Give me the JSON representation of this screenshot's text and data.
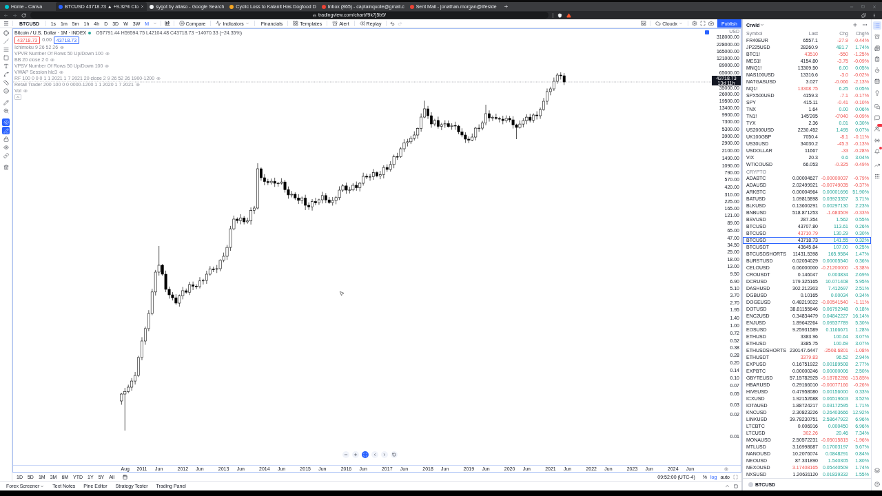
{
  "browser": {
    "tabs": [
      {
        "title": "Home - Canva",
        "selected": false
      },
      {
        "title": "BTCUSD 43718.73 ▲ +9.32% Clo",
        "selected": true
      },
      {
        "title": "sygot by aliaso - Google Search",
        "selected": false
      },
      {
        "title": "Cyclic Loss to Kalanit Has Dogfood D",
        "selected": false
      },
      {
        "title": "Inbox (865) - captainquote@gmail.c",
        "selected": false
      },
      {
        "title": "Sent Mail - jonathan.morgan@lifeside",
        "selected": false
      }
    ],
    "url": "tradingview.com/chart/f9k7j5b9/"
  },
  "toolbar": {
    "symbol": "BTCUSD",
    "intervals": [
      {
        "label": "1s",
        "selected": false
      },
      {
        "label": "1m",
        "selected": false
      },
      {
        "label": "5m",
        "selected": false
      },
      {
        "label": "1h",
        "selected": false
      },
      {
        "label": "4h",
        "selected": false
      },
      {
        "label": "D",
        "selected": false
      },
      {
        "label": "3D",
        "selected": false
      },
      {
        "label": "W",
        "selected": false
      },
      {
        "label": "3W",
        "selected": false
      },
      {
        "label": "M",
        "selected": true
      }
    ],
    "actions": [
      {
        "label": "Compare",
        "dropdown": false
      },
      {
        "label": "Indicators",
        "dropdown": true
      },
      {
        "label": "Financials",
        "dropdown": false
      },
      {
        "label": "Templates",
        "dropdown": false
      },
      {
        "label": "Alert",
        "dropdown": false
      },
      {
        "label": "Replay",
        "dropdown": false
      }
    ],
    "layout_name": "Cloudx",
    "publish": "Publish"
  },
  "drawing_tools": [
    {
      "selected": false
    },
    {
      "selected": false
    },
    {
      "selected": false
    },
    {
      "selected": false
    },
    {
      "selected": false
    },
    {
      "selected": false
    },
    {
      "selected": false
    },
    {
      "selected": false
    },
    {
      "selected": false
    },
    {
      "selected": false
    },
    {
      "selected": true
    },
    {
      "selected": true
    },
    {
      "selected": false
    },
    {
      "selected": false
    },
    {
      "selected": false
    },
    {
      "selected": false
    }
  ],
  "legend": {
    "title": "Bitcoin / U.S. Dollar · 1M · INDEX",
    "market_open": true,
    "ohlc": "O57791.44 H59594.75 L42104.48 C43718.73 −14070.33 (−24.35%)",
    "sell_price": "43718.73",
    "spread": "0.00",
    "buy_price": "43718.73",
    "indicators": [
      {
        "label": "Ichimoku 9 26 52 26",
        "visible": true
      },
      {
        "label": "VPVR Number Of Rows 50 Up/Down 100",
        "visible": true
      },
      {
        "label": "BB 20 close 2 0",
        "visible": true
      },
      {
        "label": "VPSV Number Of Rows 50 Up/Down 100",
        "visible": true
      },
      {
        "label": "VWAP Session hlc3",
        "visible": true
      },
      {
        "label": "RF 100 0 0 0 1 1 2021 1 7 2021 20 close 2 9 26 52 26 1900-1200",
        "visible": true
      },
      {
        "label": "Retail Trader 200 100 0 0 0000-1200 1 1 2020 1 7 2021",
        "visible": true
      },
      {
        "label": "Vol",
        "visible": true
      }
    ]
  },
  "chart": {
    "currency": "USD",
    "last_price": "43718.73",
    "countdown": "13d 11h",
    "price_labels": [
      "318000.00",
      "228000.00",
      "165000.00",
      "121000.00",
      "89000.00",
      "65000.00",
      "35000.00",
      "26000.00",
      "19500.00",
      "13400.00",
      "9900.00",
      "7300.00",
      "5300.00",
      "3900.00",
      "2900.00",
      "2100.00",
      "1490.00",
      "1090.00",
      "790.00",
      "570.00",
      "420.00",
      "310.00",
      "225.00",
      "165.00",
      "121.00",
      "89.00",
      "65.00",
      "47.00",
      "34.50",
      "25.00",
      "18.00",
      "13.00",
      "9.50",
      "6.90",
      "5.10",
      "3.70",
      "2.70",
      "1.95",
      "1.40",
      "1.00",
      "0.72",
      "0.52",
      "0.38",
      "0.28",
      "0.20",
      "0.14",
      "0.10",
      "0.07",
      "0.05",
      "0.03",
      "0.02",
      "0.01"
    ],
    "time_labels": [
      "Aug",
      "2011",
      "Jun",
      "2012",
      "Jun",
      "2013",
      "Jun",
      "2014",
      "Jun",
      "2015",
      "Jun",
      "2016",
      "Jun",
      "2017",
      "Jun",
      "2018",
      "Jun",
      "2019",
      "Jun",
      "2020",
      "Jun",
      "2021",
      "Jun",
      "2022",
      "Jun",
      "2023",
      "Jun",
      "2024",
      "Jun"
    ]
  },
  "range_bar": {
    "ranges": [
      "1D",
      "5D",
      "1M",
      "3M",
      "6M",
      "YTD",
      "1Y",
      "5Y",
      "All"
    ],
    "clock": "09:52:00 (UTC-4)",
    "scale_options": [
      {
        "label": "%",
        "selected": false
      },
      {
        "label": "log",
        "selected": true
      },
      {
        "label": "auto",
        "selected": false
      }
    ]
  },
  "bottom_tabs": [
    {
      "label": "Forex Screener",
      "dropdown": true
    },
    {
      "label": "Text Notes",
      "dropdown": false
    },
    {
      "label": "Pine Editor",
      "dropdown": false
    },
    {
      "label": "Strategy Tester",
      "dropdown": false
    },
    {
      "label": "Trading Panel",
      "dropdown": false
    }
  ],
  "watchlist": {
    "name": "Crwld",
    "columns": [
      "Symbol",
      "Last",
      "Chg",
      "Chg%"
    ],
    "groups": [
      {
        "rows": [
          {
            "symbol": "FR40EUR",
            "last": "6557.1",
            "chg": "-27.9",
            "chg_pct": "-0.44%",
            "positive": false,
            "last_down": false,
            "selected": false
          },
          {
            "symbol": "JP225USD",
            "last": "28260.9",
            "chg": "481.7",
            "chg_pct": "1.74%",
            "positive": true,
            "last_down": false,
            "selected": false
          },
          {
            "symbol": "BTC1!",
            "last": "43510",
            "chg": "-550",
            "chg_pct": "-1.25%",
            "positive": false,
            "last_down": true,
            "selected": false
          },
          {
            "symbol": "MES1!",
            "last": "4154.80",
            "chg": "-3.75",
            "chg_pct": "-0.09%",
            "positive": false,
            "last_down": false,
            "selected": false
          },
          {
            "symbol": "MNQ1!",
            "last": "13309.50",
            "chg": "6.00",
            "chg_pct": "0.05%",
            "positive": true,
            "last_down": false,
            "selected": false
          },
          {
            "symbol": "NAS100USD",
            "last": "13316.6",
            "chg": "-3.0",
            "chg_pct": "-0.02%",
            "positive": false,
            "last_down": false,
            "selected": false
          },
          {
            "symbol": "NATGASUSD",
            "last": "3.027",
            "chg": "-0.066",
            "chg_pct": "-2.13%",
            "positive": false,
            "last_down": false,
            "selected": false
          },
          {
            "symbol": "NQ1!",
            "last": "13308.75",
            "chg": "6.25",
            "chg_pct": "0.05%",
            "positive": true,
            "last_down": true,
            "selected": false
          },
          {
            "symbol": "SPX500USD",
            "last": "4159.3",
            "chg": "-7.1",
            "chg_pct": "-0.17%",
            "positive": false,
            "last_down": false,
            "selected": false
          },
          {
            "symbol": "SPY",
            "last": "415.11",
            "chg": "-0.41",
            "chg_pct": "-0.10%",
            "positive": false,
            "last_down": false,
            "selected": false
          },
          {
            "symbol": "TNX",
            "last": "1.64",
            "chg": "0.00",
            "chg_pct": "0.06%",
            "positive": true,
            "last_down": false,
            "selected": false
          },
          {
            "symbol": "TN1!",
            "last": "145'205",
            "chg": "-0'040",
            "chg_pct": "-0.09%",
            "positive": false,
            "last_down": false,
            "selected": false
          },
          {
            "symbol": "TYX",
            "last": "2.36",
            "chg": "0.01",
            "chg_pct": "0.30%",
            "positive": true,
            "last_down": false,
            "selected": false
          },
          {
            "symbol": "US2000USD",
            "last": "2230.452",
            "chg": "1.495",
            "chg_pct": "0.07%",
            "positive": true,
            "last_down": false,
            "selected": false
          },
          {
            "symbol": "UK100GBP",
            "last": "7050.4",
            "chg": "-8.1",
            "chg_pct": "-0.11%",
            "positive": false,
            "last_down": false,
            "selected": false
          },
          {
            "symbol": "US30USD",
            "last": "34030.2",
            "chg": "-45.3",
            "chg_pct": "-0.13%",
            "positive": false,
            "last_down": false,
            "selected": false
          },
          {
            "symbol": "USDOLLAR",
            "last": "11667",
            "chg": "-33",
            "chg_pct": "-0.28%",
            "positive": false,
            "last_down": false,
            "selected": false
          },
          {
            "symbol": "VIX",
            "last": "20.3",
            "chg": "0.6",
            "chg_pct": "3.04%",
            "positive": true,
            "last_down": false,
            "selected": false
          },
          {
            "symbol": "WTICOUSD",
            "last": "66.053",
            "chg": "-0.325",
            "chg_pct": "-0.49%",
            "positive": false,
            "last_down": false,
            "selected": false
          }
        ]
      },
      {
        "title": "CRYPTO",
        "rows": [
          {
            "symbol": "ADABTC",
            "last": "0.00004627",
            "chg": "-0.00000037",
            "chg_pct": "-0.79%",
            "positive": false,
            "last_down": false,
            "selected": false
          },
          {
            "symbol": "ADAUSD",
            "last": "2.02499921",
            "chg": "-0.00749035",
            "chg_pct": "-0.37%",
            "positive": false,
            "last_down": false,
            "selected": false
          },
          {
            "symbol": "ARKBTC",
            "last": "0.00004964",
            "chg": "0.00001696",
            "chg_pct": "51.90%",
            "positive": true,
            "last_down": false,
            "selected": false
          },
          {
            "symbol": "BATUSD",
            "last": "1.09815898",
            "chg": "0.03923357",
            "chg_pct": "3.71%",
            "positive": true,
            "last_down": false,
            "selected": false
          },
          {
            "symbol": "BLKUSD",
            "last": "0.13600291",
            "chg": "0.00297130",
            "chg_pct": "2.23%",
            "positive": true,
            "last_down": false,
            "selected": false
          },
          {
            "symbol": "BNBUSD",
            "last": "518.871253",
            "chg": "-1.683509",
            "chg_pct": "-0.33%",
            "positive": false,
            "last_down": false,
            "selected": false
          },
          {
            "symbol": "BSVUSD",
            "last": "287.354",
            "chg": "1.562",
            "chg_pct": "0.55%",
            "positive": true,
            "last_down": false,
            "selected": false
          },
          {
            "symbol": "BTCUSD",
            "last": "43707.80",
            "chg": "113.61",
            "chg_pct": "0.26%",
            "positive": true,
            "last_down": false,
            "selected": false
          },
          {
            "symbol": "BTCUSD",
            "last": "43710.79",
            "chg": "130.29",
            "chg_pct": "0.30%",
            "positive": true,
            "last_down": true,
            "selected": false
          },
          {
            "symbol": "BTCUSD",
            "last": "43718.73",
            "chg": "141.55",
            "chg_pct": "0.32%",
            "positive": true,
            "last_down": false,
            "selected": true
          },
          {
            "symbol": "BTCUSDT",
            "last": "43645.84",
            "chg": "107.00",
            "chg_pct": "0.25%",
            "positive": true,
            "last_down": false,
            "selected": false
          },
          {
            "symbol": "BTCUSDSHORTS",
            "last": "11431.5398",
            "chg": "165.9584",
            "chg_pct": "1.47%",
            "positive": true,
            "last_down": false,
            "selected": false
          },
          {
            "symbol": "BURSTUSD",
            "last": "0.02054029",
            "chg": "0.00005540",
            "chg_pct": "0.36%",
            "positive": true,
            "last_down": false,
            "selected": false
          },
          {
            "symbol": "CELOUSD",
            "last": "6.06000000",
            "chg": "-0.21200000",
            "chg_pct": "-3.38%",
            "positive": false,
            "last_down": false,
            "selected": false
          },
          {
            "symbol": "CROUSDT",
            "last": "0.146047",
            "chg": "0.003834",
            "chg_pct": "2.69%",
            "positive": true,
            "last_down": false,
            "selected": false
          },
          {
            "symbol": "DCRUSD",
            "last": "179.325165",
            "chg": "10.071408",
            "chg_pct": "5.95%",
            "positive": true,
            "last_down": false,
            "selected": false
          },
          {
            "symbol": "DASHUSD",
            "last": "302.212303",
            "chg": "7.412697",
            "chg_pct": "2.51%",
            "positive": true,
            "last_down": false,
            "selected": false
          },
          {
            "symbol": "DGBUSD",
            "last": "0.10165",
            "chg": "0.00034",
            "chg_pct": "0.34%",
            "positive": true,
            "last_down": false,
            "selected": false
          },
          {
            "symbol": "DOGEUSD",
            "last": "0.48219022",
            "chg": "-0.00541540",
            "chg_pct": "-1.11%",
            "positive": false,
            "last_down": false,
            "selected": false
          },
          {
            "symbol": "DOTUSD",
            "last": "38.81155646",
            "chg": "0.06792948",
            "chg_pct": "0.18%",
            "positive": true,
            "last_down": false,
            "selected": false
          },
          {
            "symbol": "ENC2USD",
            "last": "0.34834479",
            "chg": "0.04842227",
            "chg_pct": "16.14%",
            "positive": true,
            "last_down": false,
            "selected": false
          },
          {
            "symbol": "ENJUSD",
            "last": "1.89642264",
            "chg": "0.09537789",
            "chg_pct": "5.30%",
            "positive": true,
            "last_down": false,
            "selected": false
          },
          {
            "symbol": "EOSUSD",
            "last": "9.25931589",
            "chg": "0.1166671",
            "chg_pct": "1.28%",
            "positive": true,
            "last_down": false,
            "selected": false
          },
          {
            "symbol": "ETHUSD",
            "last": "3383.96",
            "chg": "100.64",
            "chg_pct": "3.07%",
            "positive": true,
            "last_down": false,
            "selected": false
          },
          {
            "symbol": "ETHUSD",
            "last": "3385.75",
            "chg": "100.69",
            "chg_pct": "3.07%",
            "positive": true,
            "last_down": false,
            "selected": false
          },
          {
            "symbol": "ETHUSDSHORTS",
            "last": "230147.6447",
            "chg": "-2508.6801",
            "chg_pct": "-1.08%",
            "positive": false,
            "last_down": false,
            "selected": false
          },
          {
            "symbol": "ETHUSDT",
            "last": "3379.83",
            "chg": "96.52",
            "chg_pct": "2.94%",
            "positive": true,
            "last_down": true,
            "selected": false
          },
          {
            "symbol": "EXPUSD",
            "last": "0.16751922",
            "chg": "0.00189508",
            "chg_pct": "2.77%",
            "positive": true,
            "last_down": false,
            "selected": false
          },
          {
            "symbol": "EXPBTC",
            "last": "0.00000246",
            "chg": "0.00000006",
            "chg_pct": "2.50%",
            "positive": true,
            "last_down": false,
            "selected": false
          },
          {
            "symbol": "GBYTEUSD",
            "last": "57.15782925",
            "chg": "-9.18782286",
            "chg_pct": "-13.85%",
            "positive": false,
            "last_down": false,
            "selected": false
          },
          {
            "symbol": "HBARUSD",
            "last": "0.29166010",
            "chg": "-0.00077166",
            "chg_pct": "-0.26%",
            "positive": false,
            "last_down": false,
            "selected": false
          },
          {
            "symbol": "HIVEUSD",
            "last": "0.47958080",
            "chg": "0.00156000",
            "chg_pct": "0.33%",
            "positive": true,
            "last_down": false,
            "selected": false
          },
          {
            "symbol": "ICXUSD",
            "last": "1.92152688",
            "chg": "0.06519603",
            "chg_pct": "3.52%",
            "positive": true,
            "last_down": false,
            "selected": false
          },
          {
            "symbol": "IOTAUSD",
            "last": "1.88724217",
            "chg": "0.03172595",
            "chg_pct": "1.71%",
            "positive": true,
            "last_down": false,
            "selected": false
          },
          {
            "symbol": "KNCUSD",
            "last": "2.30823226",
            "chg": "0.26403666",
            "chg_pct": "12.92%",
            "positive": true,
            "last_down": false,
            "selected": false
          },
          {
            "symbol": "LINKUSD",
            "last": "39.78230751",
            "chg": "2.58647922",
            "chg_pct": "6.96%",
            "positive": true,
            "last_down": false,
            "selected": false
          },
          {
            "symbol": "LTCBTC",
            "last": "0.006916",
            "chg": "0.000450",
            "chg_pct": "6.96%",
            "positive": true,
            "last_down": false,
            "selected": false
          },
          {
            "symbol": "LTCUSD",
            "last": "302.26",
            "chg": "20.46",
            "chg_pct": "7.34%",
            "positive": true,
            "last_down": true,
            "selected": false
          },
          {
            "symbol": "MONAUSD",
            "last": "2.50572231",
            "chg": "-0.05015815",
            "chg_pct": "-1.96%",
            "positive": false,
            "last_down": false,
            "selected": false
          },
          {
            "symbol": "MTLUSD",
            "last": "3.16998687",
            "chg": "0.17003197",
            "chg_pct": "5.67%",
            "positive": true,
            "last_down": false,
            "selected": false
          },
          {
            "symbol": "NANOUSD",
            "last": "10.2076074",
            "chg": "0.0848291",
            "chg_pct": "0.84%",
            "positive": true,
            "last_down": false,
            "selected": false
          },
          {
            "symbol": "NEOUSD",
            "last": "87.331890",
            "chg": "1.540305",
            "chg_pct": "1.80%",
            "positive": true,
            "last_down": false,
            "selected": false
          },
          {
            "symbol": "NEXOUSD",
            "last": "3.17408165",
            "chg": "0.05440509",
            "chg_pct": "1.74%",
            "positive": true,
            "last_down": true,
            "selected": false
          },
          {
            "symbol": "NXSUSD",
            "last": "1.20631120",
            "chg": "0.01839332",
            "chg_pct": "1.55%",
            "positive": true,
            "last_down": false,
            "selected": false
          }
        ]
      }
    ],
    "detail_symbol": "BTCUSD"
  },
  "sidebar_icons": [
    {
      "selected": true,
      "badge": false
    },
    {
      "selected": false,
      "badge": false
    },
    {
      "selected": false,
      "badge": false
    },
    {
      "selected": false,
      "badge": false
    },
    {
      "selected": false,
      "badge": false
    },
    {
      "selected": false,
      "badge": false
    },
    {
      "selected": false,
      "badge": false
    },
    {
      "selected": false,
      "badge": false
    },
    {
      "selected": false,
      "badge": false
    },
    {
      "selected": false,
      "badge": true
    },
    {
      "selected": false,
      "badge": false
    },
    {
      "selected": false,
      "badge": true
    },
    {
      "selected": false,
      "badge": false
    },
    {
      "selected": false,
      "badge": false
    },
    {
      "selected": false,
      "badge": false
    },
    {
      "selected": false,
      "badge": false
    }
  ]
}
